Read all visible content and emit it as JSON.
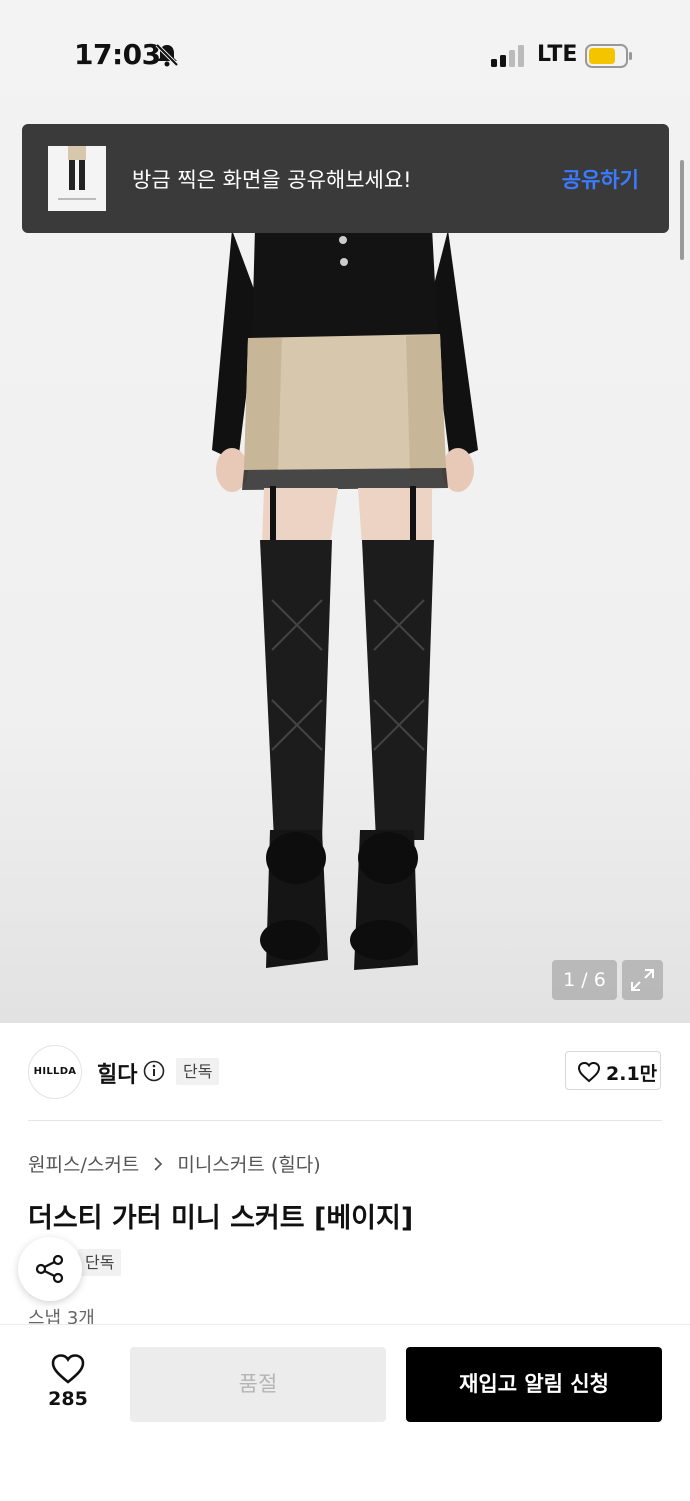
{
  "status_bar": {
    "time": "17:03",
    "network": "LTE",
    "icons": [
      "bell-slash-icon",
      "signal-icon",
      "battery-icon"
    ]
  },
  "toast": {
    "message": "방금 찍은 화면을 공유해보세요!",
    "action_label": "공유하기",
    "action_color": "#3a7bff"
  },
  "gallery": {
    "counter": "1 / 6",
    "expand_icon": "expand-icon"
  },
  "brand": {
    "logo_text": "HILLDA",
    "name": "힐다",
    "info_icon": "info-icon",
    "badge": "단독",
    "likes": "2.1만"
  },
  "product": {
    "breadcrumb": [
      "원피스/스커트",
      "미니스커트 (힐다)"
    ],
    "title": "더스티 가터 미니 스커트 [베이지]",
    "tag": "단독",
    "snap": "스냅 3개"
  },
  "bottom_bar": {
    "wish_count": "285",
    "soldout_label": "품절",
    "restock_label": "재입고 알림 신청"
  }
}
